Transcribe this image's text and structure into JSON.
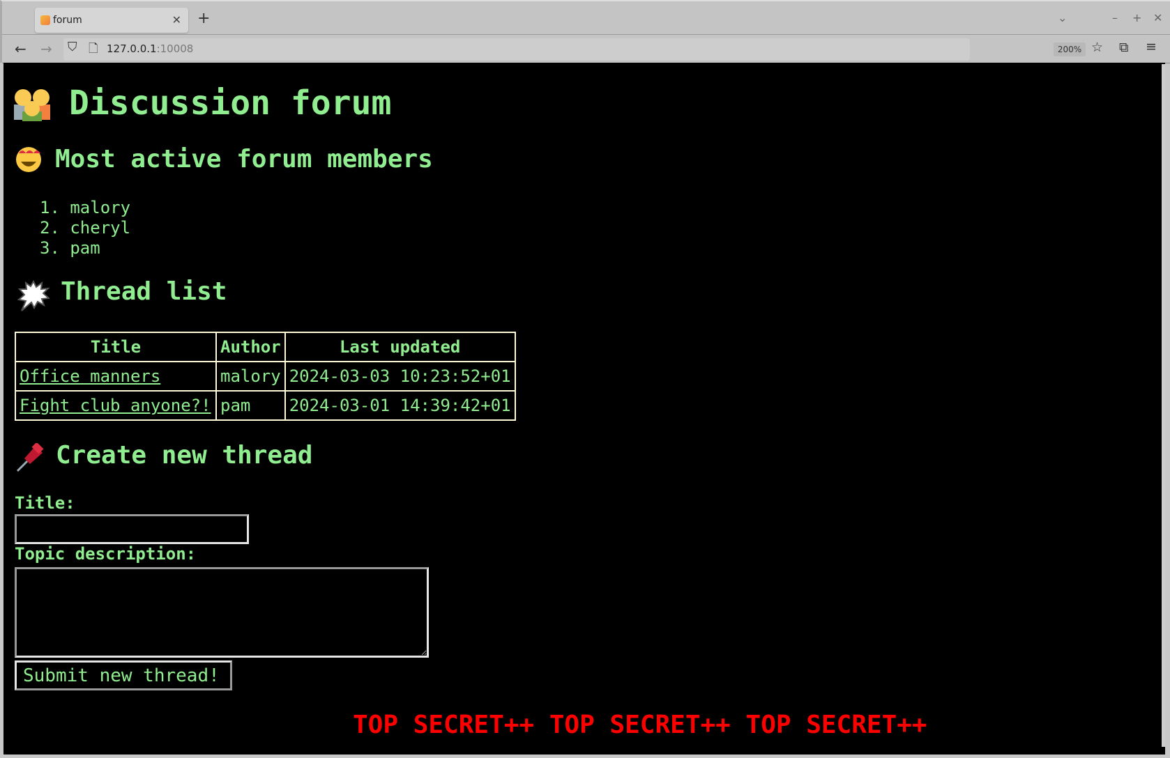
{
  "browser": {
    "tab_title": "forum",
    "url_host": "127.0.0.1",
    "url_port": ":10008",
    "zoom": "200%"
  },
  "page": {
    "title": "Discussion forum",
    "members_heading": "Most active forum members",
    "members": [
      "1. malory",
      "2. cheryl",
      "3. pam"
    ],
    "threads_heading": "Thread list",
    "table": {
      "headers": [
        "Title",
        "Author",
        "Last updated"
      ],
      "rows": [
        {
          "title": "Office manners",
          "author": "malory",
          "updated": "2024-03-03 10:23:52+01"
        },
        {
          "title": "Fight club anyone?!",
          "author": "pam",
          "updated": "2024-03-01 14:39:42+01"
        }
      ]
    },
    "create_heading": "Create new thread",
    "form": {
      "title_label": "Title:",
      "title_value": "",
      "description_label": "Topic description:",
      "description_value": "",
      "submit_label": "Submit new thread!"
    },
    "footer_banner": "TOP SECRET++ TOP SECRET++ TOP SECRET++",
    "colors": {
      "text": "#90ee90",
      "banner": "#ff0000",
      "background": "#000000"
    }
  }
}
